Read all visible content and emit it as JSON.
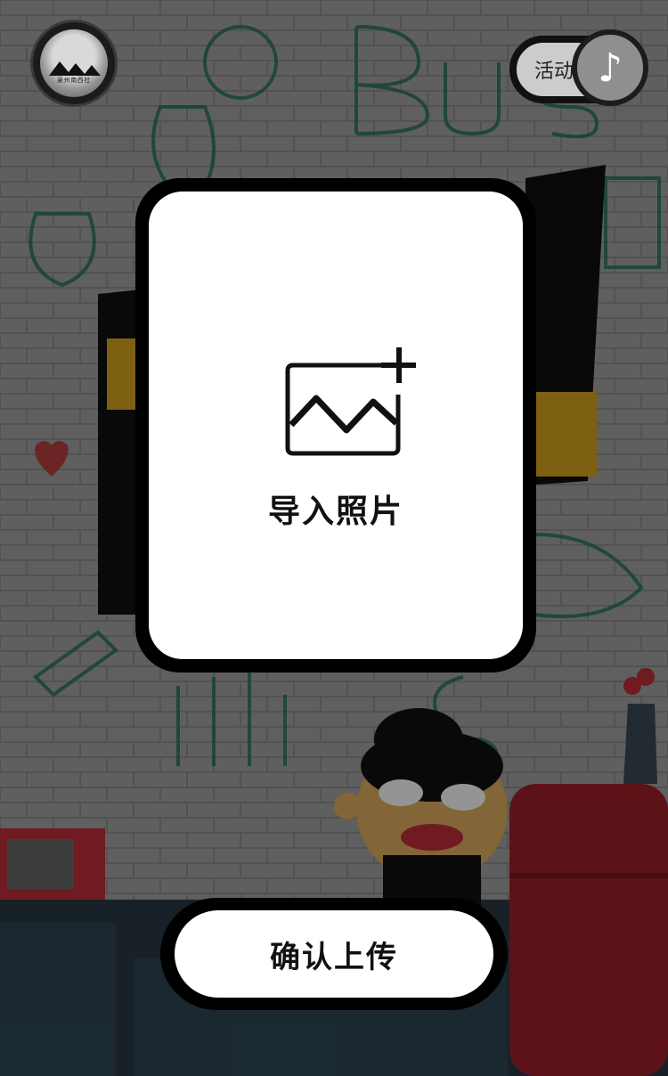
{
  "header": {
    "logo_text": "泉州南西社",
    "activity_label": "活动",
    "music_icon": "music-note-icon"
  },
  "upload": {
    "label": "导入照片",
    "icon": "add-image-icon"
  },
  "confirm": {
    "label": "确认上传"
  },
  "colors": {
    "card_border": "#000000",
    "card_bg": "#ffffff",
    "overlay": "rgba(0,0,0,0.42)"
  }
}
